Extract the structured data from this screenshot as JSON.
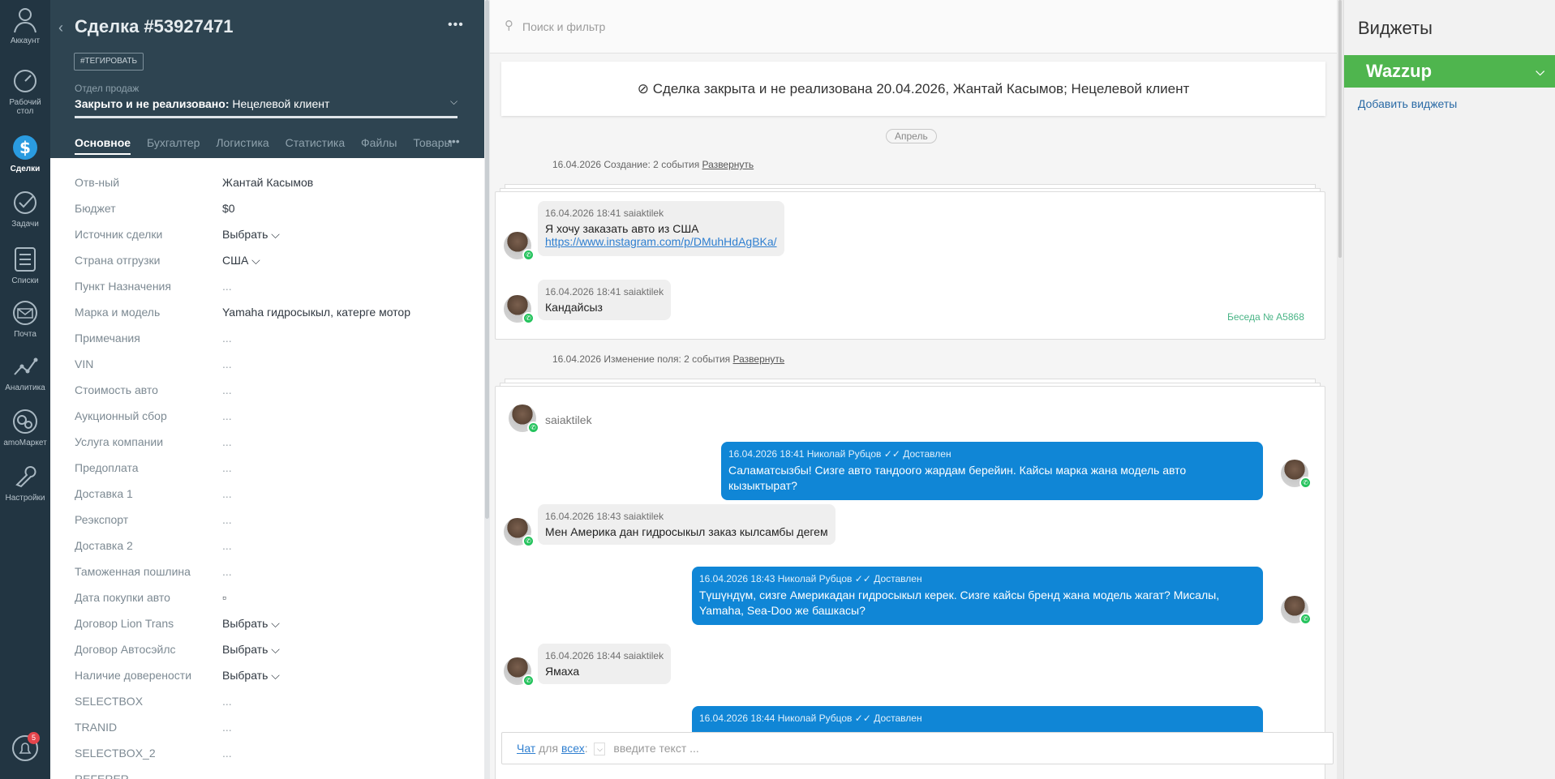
{
  "nav": {
    "items": [
      {
        "label": "Аккаунт",
        "icon": "account-icon"
      },
      {
        "label": "Рабочий стол",
        "icon": "dashboard-icon"
      },
      {
        "label": "Сделки",
        "icon": "deals-icon"
      },
      {
        "label": "Задачи",
        "icon": "tasks-icon"
      },
      {
        "label": "Списки",
        "icon": "lists-icon"
      },
      {
        "label": "Почта",
        "icon": "mail-icon"
      },
      {
        "label": "Аналитика",
        "icon": "analytics-icon"
      },
      {
        "label": "amoМаркет",
        "icon": "market-icon"
      },
      {
        "label": "Настройки",
        "icon": "settings-icon"
      }
    ],
    "notifications_count": "5"
  },
  "deal": {
    "title": "Сделка #53927471",
    "tag_button": "#ТЕГИРОВАТЬ",
    "pipeline_label": "Отдел продаж",
    "status_bold": "Закрыто и не реализовано:",
    "status_reason": "Нецелевой клиент",
    "tabs": [
      "Основное",
      "Бухгалтер",
      "Логистика",
      "Статистика",
      "Файлы",
      "Товары"
    ],
    "fields": [
      {
        "label": "Отв-ный",
        "value": "Жантай Касымов"
      },
      {
        "label": "Бюджет",
        "value": "$0"
      },
      {
        "label": "Источник сделки",
        "value": "Выбрать ⌵"
      },
      {
        "label": "Страна отгрузки",
        "value": "США ⌵"
      },
      {
        "label": "Пункт Назначения",
        "value": "..."
      },
      {
        "label": "Марка и модель",
        "value": "Yamaha гидросыкыл, катерге мотор"
      },
      {
        "label": "Примечания",
        "value": "..."
      },
      {
        "label": "VIN",
        "value": "..."
      },
      {
        "label": "Стоимость авто",
        "value": "..."
      },
      {
        "label": "Аукционный сбор",
        "value": "..."
      },
      {
        "label": "Услуга компании",
        "value": "..."
      },
      {
        "label": "Предоплата",
        "value": "..."
      },
      {
        "label": "Доставка 1",
        "value": "..."
      },
      {
        "label": "Реэкспорт",
        "value": "..."
      },
      {
        "label": "Доставка 2",
        "value": "..."
      },
      {
        "label": "Таможенная пошлина",
        "value": "..."
      },
      {
        "label": "Дата покупки авто",
        "value": "▫"
      },
      {
        "label": "Договор Lion Trans",
        "value": "Выбрать ⌵"
      },
      {
        "label": "Договор Автосэйлс",
        "value": "Выбрать ⌵"
      },
      {
        "label": "Наличие доверености",
        "value": "Выбрать ⌵"
      },
      {
        "label": "SELECTBOX",
        "value": "..."
      },
      {
        "label": "TRANID",
        "value": "..."
      },
      {
        "label": "SELECTBOX_2",
        "value": "..."
      },
      {
        "label": "REFERER",
        "value": ""
      }
    ]
  },
  "feed": {
    "search_placeholder": "Поиск и фильтр",
    "closed_banner": "Сделка закрыта и не реализована 20.04.2026, Жантай Касымов; Нецелевой клиент",
    "month": "Апрель",
    "group1": {
      "text": "16.04.2026 Создание: 2 события",
      "link": "Развернуть"
    },
    "group2": {
      "text": "16.04.2026 Изменение поля: 2 события",
      "link": "Развернуть"
    },
    "conversation_label": "Беседа № A5868",
    "contact_name": "saiaktilek",
    "messages": [
      {
        "meta": "16.04.2026 18:41 saiaktilek",
        "text": "Я хочу заказать авто из США",
        "link": "https://www.instagram.com/p/DMuhHdAgBKa/"
      },
      {
        "meta": "16.04.2026 18:41 saiaktilek",
        "text": "Кандайсыз"
      },
      {
        "meta": "16.04.2026 18:41 Николай Рубцов ✓✓ Доставлен",
        "text": "Саламатсызбы! Сизге авто тандоого жардам берейин. Кайсы марка жана модель авто кызыктырат?"
      },
      {
        "meta": "16.04.2026 18:43 saiaktilek",
        "text": "Мен Америка дан гидросыкыл заказ кылсамбы дегем"
      },
      {
        "meta": "16.04.2026 18:43 Николай Рубцов ✓✓ Доставлен",
        "text": "Түшүндүм, сизге Америкадан гидросыкыл керек. Сизге кайсы бренд жана модель жагат? Мисалы, Yamaha, Sea-Doo же башкасы?"
      },
      {
        "meta": "16.04.2026 18:44 saiaktilek",
        "text": "Ямаха"
      },
      {
        "meta": "16.04.2026 18:44 Николай Рубцов ✓✓ Доставлен",
        "text": ""
      }
    ],
    "compose": {
      "chat": "Чат",
      "for": "для",
      "all": "всех",
      "placeholder": "введите текст ..."
    }
  },
  "widgets": {
    "title": "Виджеты",
    "wazzup": "Wazzup",
    "add": "Добавить виджеты"
  }
}
